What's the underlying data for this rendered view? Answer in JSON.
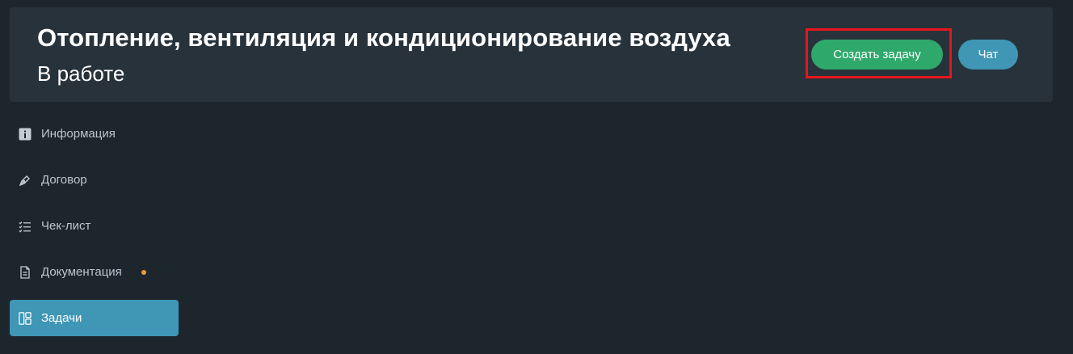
{
  "header": {
    "title": "Отопление, вентиляция и кондиционирование воздуха",
    "status": "В работе",
    "create_task_label": "Создать задачу",
    "chat_label": "Чат"
  },
  "sidebar": {
    "items": [
      {
        "label": "Информация",
        "icon": "info-icon",
        "active": false
      },
      {
        "label": "Договор",
        "icon": "pen-icon",
        "active": false
      },
      {
        "label": "Чек-лист",
        "icon": "checklist-icon",
        "active": false
      },
      {
        "label": "Документация",
        "icon": "document-icon",
        "active": false,
        "notification_dot": true
      },
      {
        "label": "Задачи",
        "icon": "tasks-board-icon",
        "active": true
      }
    ]
  },
  "colors": {
    "background": "#1e262d",
    "header_card": "#28323b",
    "create_button": "#2fa86b",
    "chat_button": "#3f96b5",
    "active_nav": "#3f96b5",
    "highlight_box": "#e8151b",
    "notification_dot": "#e5a13b"
  }
}
